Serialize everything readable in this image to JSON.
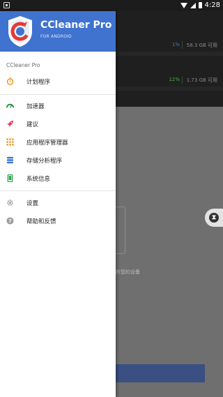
{
  "status_bar": {
    "time": "4:28"
  },
  "background": {
    "storage_rows": [
      {
        "percent": "1%",
        "available": "58.3 GB 可用"
      },
      {
        "percent": "12%",
        "available": "1.73 GB 可用"
      }
    ],
    "device_text": "析您的设备"
  },
  "drawer": {
    "header": {
      "title": "CCleaner Pro",
      "subtitle": "FOR ANDROID",
      "brand_color": "#3f73cf"
    },
    "section_label": "CCleaner Pro",
    "items": [
      {
        "label": "计划程序",
        "icon": "timer-icon",
        "color": "#f08c00"
      },
      {
        "label": "加速器",
        "icon": "speedometer-icon",
        "color": "#1e8e3e"
      },
      {
        "label": "建议",
        "icon": "rocket-icon",
        "color": "#e53958"
      },
      {
        "label": "应用程序管理器",
        "icon": "apps-grid-icon",
        "color": "#f08c00"
      },
      {
        "label": "存储分析程序",
        "icon": "storage-stack-icon",
        "color": "#3f73cf"
      },
      {
        "label": "系统信息",
        "icon": "phone-icon",
        "color": "#2fa84f"
      },
      {
        "label": "设置",
        "icon": "gear-icon",
        "color": "#9e9e9e"
      },
      {
        "label": "帮助和反馈",
        "icon": "help-icon",
        "color": "#9e9e9e"
      }
    ]
  }
}
